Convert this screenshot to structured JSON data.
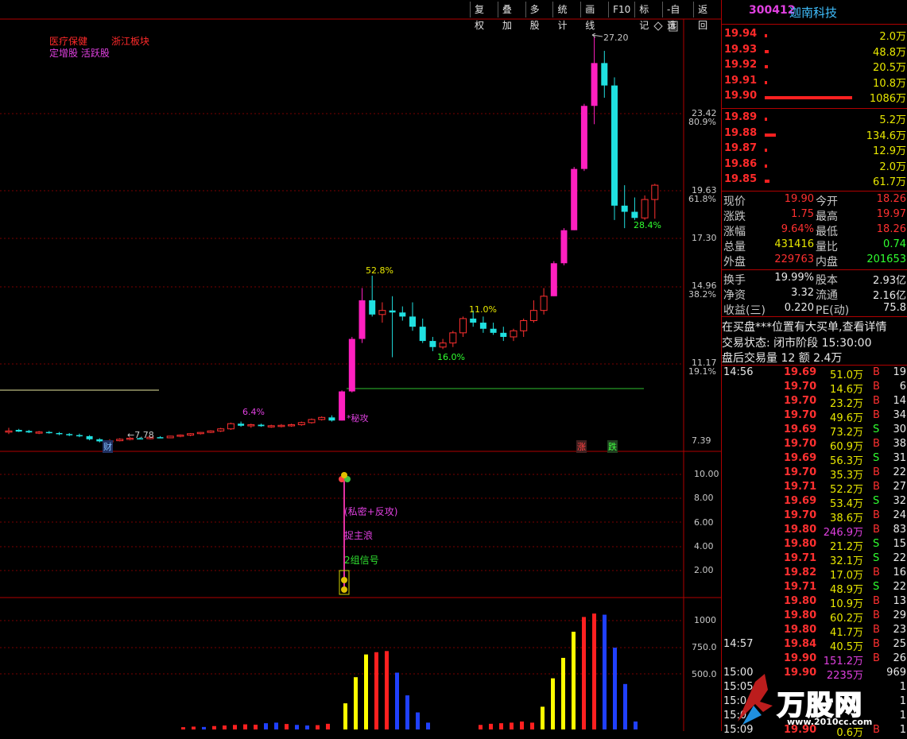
{
  "toolbar": {
    "items": [
      "复权",
      "叠加",
      "多股",
      "统计",
      "画线",
      "F10",
      "标记",
      "-自选",
      "返回"
    ]
  },
  "stock": {
    "code": "300412",
    "name": "迦南科技"
  },
  "sectors": {
    "line1a": "医疗保健",
    "line1b": "浙江板块",
    "line2": "定增股 活跃股"
  },
  "main_axis": [
    {
      "price": "23.42",
      "pct": "80.9%",
      "y": 141
    },
    {
      "price": "19.63",
      "pct": "61.8%",
      "y": 238
    },
    {
      "price": "17.30",
      "pct": "",
      "y": 298
    },
    {
      "price": "14.96",
      "pct": "38.2%",
      "y": 358
    },
    {
      "price": "11.17",
      "pct": "19.1%",
      "y": 455
    },
    {
      "price": "7.39",
      "pct": "",
      "y": 553
    }
  ],
  "indicator_axis": [
    "10.00",
    "8.00",
    "6.00",
    "4.00",
    "2.00"
  ],
  "volume_axis": [
    "1000",
    "750.0",
    "500.0"
  ],
  "annotations": {
    "high": "27.20",
    "low": "←7.78",
    "p528": "52.8%",
    "p110": "11.0%",
    "p160": "16.0%",
    "p64": "6.4%",
    "p284": "28.4%",
    "cai": "财",
    "zhang": "涨",
    "die": "跌",
    "gongji": "*秘攻"
  },
  "indicator_labels": {
    "a": "(私密+反攻)",
    "b": "捉主浪",
    "c": "2组信号"
  },
  "orderbook_sell": [
    {
      "price": "19.94",
      "vol": "2.0万",
      "bar": 3
    },
    {
      "price": "19.93",
      "vol": "48.8万",
      "bar": 5
    },
    {
      "price": "19.92",
      "vol": "20.5万",
      "bar": 4
    },
    {
      "price": "19.91",
      "vol": "10.8万",
      "bar": 3
    },
    {
      "price": "19.90",
      "vol": "1086万",
      "bar": 110
    }
  ],
  "orderbook_buy": [
    {
      "price": "19.89",
      "vol": "5.2万",
      "bar": 3
    },
    {
      "price": "19.88",
      "vol": "134.6万",
      "bar": 14
    },
    {
      "price": "19.87",
      "vol": "12.9万",
      "bar": 3
    },
    {
      "price": "19.86",
      "vol": "2.0万",
      "bar": 3
    },
    {
      "price": "19.85",
      "vol": "61.7万",
      "bar": 6
    }
  ],
  "quote": [
    {
      "l1": "现价",
      "v1": "19.90",
      "c1": "#ff3030",
      "l2": "今开",
      "v2": "18.26",
      "c2": "#ff3030"
    },
    {
      "l1": "涨跌",
      "v1": "1.75",
      "c1": "#ff3030",
      "l2": "最高",
      "v2": "19.97",
      "c2": "#ff3030"
    },
    {
      "l1": "涨幅",
      "v1": "9.64%",
      "c1": "#ff3030",
      "l2": "最低",
      "v2": "18.26",
      "c2": "#ff3030"
    },
    {
      "l1": "总量",
      "v1": "431416",
      "c1": "#e8e800",
      "l2": "量比",
      "v2": "0.74",
      "c2": "#30ff30"
    },
    {
      "l1": "外盘",
      "v1": "229763",
      "c1": "#ff3030",
      "l2": "内盘",
      "v2": "201653",
      "c2": "#30ff30"
    }
  ],
  "fundamentals": [
    {
      "l1": "换手",
      "v1": "19.99%",
      "l2": "股本",
      "v2": "2.93亿"
    },
    {
      "l1": "净资",
      "v1": "3.32",
      "l2": "流通",
      "v2": "2.16亿"
    },
    {
      "l1": "收益(三)",
      "v1": "0.220",
      "l2": "PE(动)",
      "v2": "75.8"
    }
  ],
  "notice": {
    "line1": "在买盘***位置有大买单,查看详情",
    "line2": "交易状态: 闭市阶段 15:30:00",
    "line3": "盘后交易量 12 额 2.4万"
  },
  "ticks": [
    {
      "t": "14:56",
      "p": "19.69",
      "v": "51.0万",
      "s": "B",
      "n": "19",
      "vc": "#e8e800"
    },
    {
      "t": "",
      "p": "19.70",
      "v": "14.6万",
      "s": "B",
      "n": "6",
      "vc": "#e8e800"
    },
    {
      "t": "",
      "p": "19.70",
      "v": "23.2万",
      "s": "B",
      "n": "14",
      "vc": "#e8e800"
    },
    {
      "t": "",
      "p": "19.70",
      "v": "49.6万",
      "s": "B",
      "n": "34",
      "vc": "#e8e800"
    },
    {
      "t": "",
      "p": "19.69",
      "v": "73.2万",
      "s": "S",
      "n": "30",
      "vc": "#e8e800"
    },
    {
      "t": "",
      "p": "19.70",
      "v": "60.9万",
      "s": "B",
      "n": "38",
      "vc": "#e8e800"
    },
    {
      "t": "",
      "p": "19.69",
      "v": "56.3万",
      "s": "S",
      "n": "31",
      "vc": "#e8e800"
    },
    {
      "t": "",
      "p": "19.70",
      "v": "35.3万",
      "s": "B",
      "n": "22",
      "vc": "#e8e800"
    },
    {
      "t": "",
      "p": "19.71",
      "v": "52.2万",
      "s": "B",
      "n": "27",
      "vc": "#e8e800"
    },
    {
      "t": "",
      "p": "19.69",
      "v": "53.4万",
      "s": "S",
      "n": "32",
      "vc": "#e8e800"
    },
    {
      "t": "",
      "p": "19.70",
      "v": "38.6万",
      "s": "B",
      "n": "24",
      "vc": "#e8e800"
    },
    {
      "t": "",
      "p": "19.80",
      "v": "246.9万",
      "s": "B",
      "n": "83",
      "vc": "#e040e0"
    },
    {
      "t": "",
      "p": "19.80",
      "v": "21.2万",
      "s": "S",
      "n": "15",
      "vc": "#e8e800"
    },
    {
      "t": "",
      "p": "19.71",
      "v": "32.1万",
      "s": "S",
      "n": "22",
      "vc": "#e8e800"
    },
    {
      "t": "",
      "p": "19.82",
      "v": "17.0万",
      "s": "B",
      "n": "16",
      "vc": "#e8e800"
    },
    {
      "t": "",
      "p": "19.71",
      "v": "48.9万",
      "s": "S",
      "n": "22",
      "vc": "#e8e800"
    },
    {
      "t": "",
      "p": "19.80",
      "v": "10.9万",
      "s": "B",
      "n": "13",
      "vc": "#e8e800"
    },
    {
      "t": "",
      "p": "19.80",
      "v": "60.2万",
      "s": "B",
      "n": "29",
      "vc": "#e8e800"
    },
    {
      "t": "",
      "p": "19.80",
      "v": "41.7万",
      "s": "B",
      "n": "23",
      "vc": "#e8e800"
    },
    {
      "t": "14:57",
      "p": "19.84",
      "v": "40.5万",
      "s": "B",
      "n": "25",
      "vc": "#e8e800"
    },
    {
      "t": "",
      "p": "19.90",
      "v": "151.2万",
      "s": "B",
      "n": "26",
      "vc": "#e040e0"
    },
    {
      "t": "15:00",
      "p": "19.90",
      "v": "2235万",
      "s": "",
      "n": "969",
      "vc": "#e040e0"
    },
    {
      "t": "15:05",
      "p": "",
      "v": "",
      "s": "",
      "n": "1",
      "vc": "#e8e800"
    },
    {
      "t": "15:0",
      "p": "",
      "v": "",
      "s": "",
      "n": "1",
      "vc": "#e8e800"
    },
    {
      "t": "15:0",
      "p": "",
      "v": "",
      "s": "",
      "n": "1",
      "vc": "#e8e800"
    },
    {
      "t": "15:09",
      "p": "19.90",
      "v": "0.6万",
      "s": "B",
      "n": "1",
      "vc": "#e8e800"
    }
  ],
  "watermark": {
    "title": "万股网",
    "url": "www.2010cc.com"
  },
  "chart_data": {
    "type": "candlestick",
    "candles": [
      [
        7.9,
        8.1,
        7.8,
        7.95
      ],
      [
        8.0,
        8.05,
        7.9,
        7.92
      ],
      [
        7.95,
        8.0,
        7.85,
        7.88
      ],
      [
        7.85,
        7.95,
        7.8,
        7.9
      ],
      [
        7.9,
        7.95,
        7.82,
        7.85
      ],
      [
        7.85,
        7.9,
        7.75,
        7.8
      ],
      [
        7.8,
        7.85,
        7.7,
        7.75
      ],
      [
        7.75,
        7.82,
        7.65,
        7.7
      ],
      [
        7.7,
        7.75,
        7.5,
        7.55
      ],
      [
        7.55,
        7.6,
        7.4,
        7.45
      ],
      [
        7.45,
        7.55,
        7.35,
        7.48
      ],
      [
        7.48,
        7.6,
        7.45,
        7.55
      ],
      [
        7.55,
        7.65,
        7.5,
        7.6
      ],
      [
        7.6,
        7.65,
        7.55,
        7.58
      ],
      [
        7.58,
        7.68,
        7.55,
        7.65
      ],
      [
        7.65,
        7.7,
        7.6,
        7.62
      ],
      [
        7.62,
        7.72,
        7.6,
        7.7
      ],
      [
        7.7,
        7.78,
        7.65,
        7.75
      ],
      [
        7.75,
        7.85,
        7.7,
        7.82
      ],
      [
        7.82,
        7.9,
        7.78,
        7.88
      ],
      [
        7.88,
        7.98,
        7.85,
        7.95
      ],
      [
        7.95,
        8.1,
        7.9,
        8.05
      ],
      [
        8.05,
        8.35,
        8.0,
        8.3
      ],
      [
        8.3,
        8.4,
        8.15,
        8.2
      ],
      [
        8.2,
        8.3,
        8.1,
        8.25
      ],
      [
        8.25,
        8.3,
        8.15,
        8.18
      ],
      [
        8.18,
        8.25,
        8.1,
        8.2
      ],
      [
        8.2,
        8.28,
        8.12,
        8.22
      ],
      [
        8.22,
        8.3,
        8.15,
        8.25
      ],
      [
        8.25,
        8.4,
        8.2,
        8.35
      ],
      [
        8.35,
        8.55,
        8.3,
        8.5
      ],
      [
        8.5,
        8.65,
        8.45,
        8.6
      ],
      [
        8.6,
        8.7,
        8.4,
        8.45
      ],
      [
        8.45,
        9.9,
        8.45,
        9.85
      ],
      [
        9.85,
        12.5,
        9.8,
        12.4
      ],
      [
        12.4,
        14.9,
        12.2,
        14.3
      ],
      [
        14.3,
        15.5,
        13.5,
        13.6
      ],
      [
        13.6,
        14.2,
        13.2,
        13.8
      ],
      [
        13.8,
        14.5,
        11.5,
        13.7
      ],
      [
        13.7,
        14.0,
        13.3,
        13.5
      ],
      [
        13.5,
        14.2,
        12.8,
        13.0
      ],
      [
        13.0,
        13.4,
        12.2,
        12.3
      ],
      [
        12.3,
        12.5,
        11.8,
        12.0
      ],
      [
        12.0,
        12.4,
        11.9,
        12.2
      ],
      [
        12.2,
        12.8,
        12.0,
        12.7
      ],
      [
        12.7,
        13.5,
        12.5,
        13.4
      ],
      [
        13.4,
        13.8,
        13.0,
        13.2
      ],
      [
        13.2,
        13.5,
        12.7,
        12.9
      ],
      [
        12.9,
        13.2,
        12.6,
        12.7
      ],
      [
        12.7,
        13.0,
        12.3,
        12.5
      ],
      [
        12.5,
        12.9,
        12.3,
        12.8
      ],
      [
        12.8,
        13.4,
        12.5,
        13.3
      ],
      [
        13.3,
        14.3,
        13.2,
        13.8
      ],
      [
        13.8,
        14.9,
        13.6,
        14.5
      ],
      [
        14.5,
        16.2,
        14.5,
        16.1
      ],
      [
        16.1,
        17.8,
        16.0,
        17.7
      ],
      [
        17.7,
        20.8,
        17.7,
        20.7
      ],
      [
        20.7,
        23.9,
        20.6,
        23.8
      ],
      [
        23.8,
        27.2,
        22.9,
        25.9
      ],
      [
        25.9,
        26.5,
        24.2,
        24.8
      ],
      [
        24.8,
        25.2,
        18.2,
        18.9
      ],
      [
        18.9,
        19.9,
        17.8,
        18.6
      ],
      [
        18.6,
        19.3,
        18.2,
        18.3
      ],
      [
        18.3,
        19.4,
        18.2,
        19.2
      ],
      [
        19.2,
        19.97,
        18.26,
        19.9
      ]
    ],
    "volume": [
      {
        "v": 20,
        "c": "red"
      },
      {
        "v": 25,
        "c": "red"
      },
      {
        "v": 22,
        "c": "blue"
      },
      {
        "v": 30,
        "c": "red"
      },
      {
        "v": 35,
        "c": "red"
      },
      {
        "v": 40,
        "c": "red"
      },
      {
        "v": 45,
        "c": "red"
      },
      {
        "v": 42,
        "c": "red"
      },
      {
        "v": 55,
        "c": "blue"
      },
      {
        "v": 60,
        "c": "blue"
      },
      {
        "v": 48,
        "c": "red"
      },
      {
        "v": 40,
        "c": "blue"
      },
      {
        "v": 35,
        "c": "blue"
      },
      {
        "v": 38,
        "c": "red"
      },
      {
        "v": 50,
        "c": "red"
      },
      {
        "v": 230,
        "c": "yellow"
      },
      {
        "v": 460,
        "c": "yellow"
      },
      {
        "v": 660,
        "c": "yellow"
      },
      {
        "v": 680,
        "c": "red"
      },
      {
        "v": 690,
        "c": "red"
      },
      {
        "v": 500,
        "c": "blue"
      },
      {
        "v": 300,
        "c": "blue"
      },
      {
        "v": 150,
        "c": "blue"
      },
      {
        "v": 60,
        "c": "blue"
      },
      {
        "v": 40,
        "c": "red"
      },
      {
        "v": 50,
        "c": "red"
      },
      {
        "v": 55,
        "c": "red"
      },
      {
        "v": 60,
        "c": "red"
      },
      {
        "v": 70,
        "c": "red"
      },
      {
        "v": 60,
        "c": "red"
      },
      {
        "v": 200,
        "c": "yellow"
      },
      {
        "v": 450,
        "c": "yellow"
      },
      {
        "v": 630,
        "c": "yellow"
      },
      {
        "v": 860,
        "c": "yellow"
      },
      {
        "v": 990,
        "c": "red"
      },
      {
        "v": 1020,
        "c": "red"
      },
      {
        "v": 1010,
        "c": "blue"
      },
      {
        "v": 720,
        "c": "blue"
      },
      {
        "v": 400,
        "c": "blue"
      },
      {
        "v": 70,
        "c": "blue"
      }
    ],
    "ylim": [
      7.39,
      27.2
    ]
  }
}
